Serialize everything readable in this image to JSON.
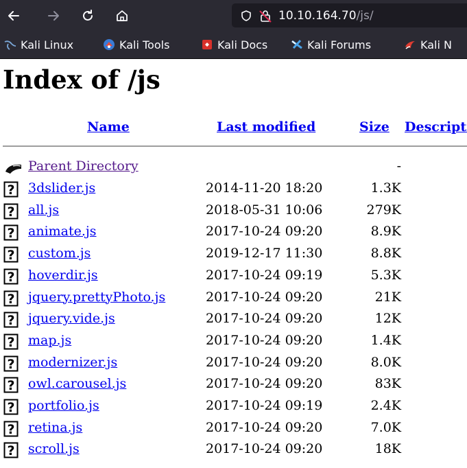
{
  "browser": {
    "url_host": "10.10.164.70",
    "url_path": "/js/"
  },
  "bookmarks": [
    {
      "label": "Kali Linux",
      "icon": "kali-dragon-icon"
    },
    {
      "label": "Kali Tools",
      "icon": "kali-tools-icon"
    },
    {
      "label": "Kali Docs",
      "icon": "kali-docs-icon"
    },
    {
      "label": "Kali Forums",
      "icon": "kali-forums-icon"
    },
    {
      "label": "Kali N",
      "icon": "kali-nethunter-icon"
    }
  ],
  "page": {
    "title": "Index of /js",
    "columns": {
      "name": "Name",
      "last_modified": "Last modified",
      "size": "Size",
      "description": "Description"
    },
    "parent": {
      "name": "Parent Directory",
      "size": "-"
    },
    "files": [
      {
        "name": "3dslider.js",
        "modified": "2014-11-20 18:20",
        "size": "1.3K"
      },
      {
        "name": "all.js",
        "modified": "2018-05-31 10:06",
        "size": "279K"
      },
      {
        "name": "animate.js",
        "modified": "2017-10-24 09:20",
        "size": "8.9K"
      },
      {
        "name": "custom.js",
        "modified": "2019-12-17 11:30",
        "size": "8.8K"
      },
      {
        "name": "hoverdir.js",
        "modified": "2017-10-24 09:19",
        "size": "5.3K"
      },
      {
        "name": "jquery.prettyPhoto.js",
        "modified": "2017-10-24 09:20",
        "size": "21K"
      },
      {
        "name": "jquery.vide.js",
        "modified": "2017-10-24 09:20",
        "size": "12K"
      },
      {
        "name": "map.js",
        "modified": "2017-10-24 09:20",
        "size": "1.4K"
      },
      {
        "name": "modernizer.js",
        "modified": "2017-10-24 09:20",
        "size": "8.0K"
      },
      {
        "name": "owl.carousel.js",
        "modified": "2017-10-24 09:20",
        "size": "83K"
      },
      {
        "name": "portfolio.js",
        "modified": "2017-10-24 09:19",
        "size": "2.4K"
      },
      {
        "name": "retina.js",
        "modified": "2017-10-24 09:20",
        "size": "7.0K"
      },
      {
        "name": "scroll.js",
        "modified": "2017-10-24 09:20",
        "size": "18K"
      }
    ]
  }
}
